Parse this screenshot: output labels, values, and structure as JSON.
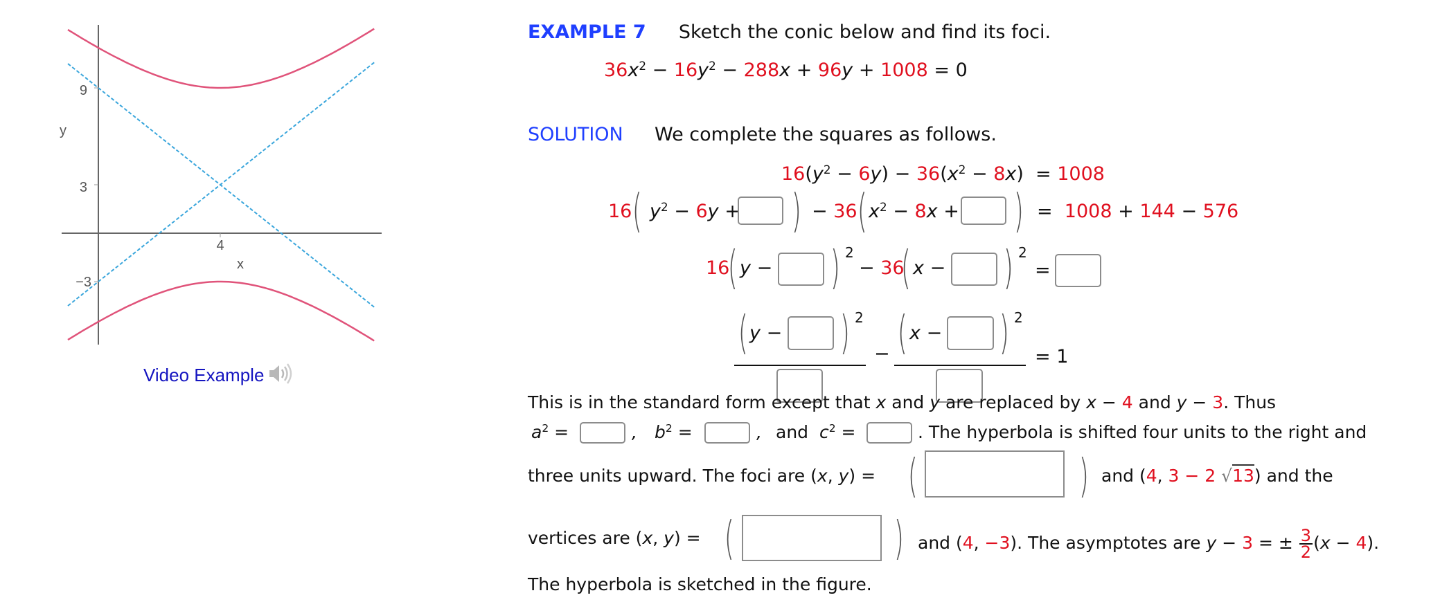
{
  "figure": {
    "axis_labels": {
      "x": "x",
      "y": "y"
    },
    "ticks": {
      "x": [
        "4"
      ],
      "y": [
        "9",
        "3",
        "−3"
      ]
    },
    "colors": {
      "hyperbola": "#e0537a",
      "asymptote": "#3aa6dc",
      "axis": "#666666"
    },
    "video_example_label": "Video Example",
    "audio_icon": "speaker-icon"
  },
  "chart_data": {
    "type": "line",
    "title": "",
    "xlabel": "x",
    "ylabel": "y",
    "xlim": [
      -1,
      9
    ],
    "ylim": [
      -7,
      13
    ],
    "xticks": [
      4
    ],
    "yticks": [
      9,
      3,
      -3
    ],
    "grid": false,
    "series": [
      {
        "name": "hyperbola-upper",
        "style": "solid",
        "equation": "(y-3)^2/36 - (x-4)^2/16 = 1, upper branch"
      },
      {
        "name": "hyperbola-lower",
        "style": "solid",
        "equation": "(y-3)^2/36 - (x-4)^2/16 = 1, lower branch"
      },
      {
        "name": "asymptote-positive",
        "style": "dashed",
        "equation": "y - 3 = 3/2 (x - 4)"
      },
      {
        "name": "asymptote-negative",
        "style": "dashed",
        "equation": "y - 3 = -3/2 (x - 4)"
      }
    ],
    "center": [
      4,
      3
    ],
    "a": 6,
    "b": 4
  },
  "example": {
    "label": "EXAMPLE 7",
    "prompt": "Sketch the conic below and find its foci.",
    "equation": {
      "c1": "36",
      "v1": "x",
      "t1": " − ",
      "c2": "16",
      "v2": "y",
      "t2": " − ",
      "c3": "288",
      "v3": "x",
      "t3": " + ",
      "c4": "96",
      "v4": "y",
      "t4": " + ",
      "c5": "1008",
      "t5": " = 0",
      "exp": "2"
    }
  },
  "solution": {
    "label": "SOLUTION",
    "intro": "We complete the squares as follows.",
    "row1": {
      "a": "16",
      "b": "(",
      "c": "y",
      "d": "2",
      "e": " − ",
      "f": "6",
      "g": "y",
      "h": ") − ",
      "i": "36",
      "j": "(",
      "k": "x",
      "l": "2",
      "m": " − ",
      "n": "8",
      "o": "x",
      "p": ")",
      "eq": "= ",
      "rhs": "1008"
    },
    "row2": {
      "c1": "16",
      "y": "y",
      "exp": "2",
      "m1": " − ",
      "c2": "6",
      "y2": "y",
      "plus": " +",
      "minus36": "− ",
      "c3": "36",
      "x": "x",
      "m2": " − ",
      "c4": "8",
      "x2": "x",
      "plus2": " +",
      "eq": "=",
      "r1": "1008",
      "p": " + ",
      "r2": "144",
      "m": " − ",
      "r3": "576"
    },
    "row3": {
      "c1": "16",
      "y": "y",
      "m1": " −",
      "exp": "2",
      "minus": "−",
      "c2": "36",
      "x": "x",
      "m2": " −",
      "eq": "="
    },
    "row4": {
      "y": "y",
      "m1": " −",
      "exp": "2",
      "minus": "−",
      "x": "x",
      "m2": " −",
      "eq": "= 1"
    },
    "para": {
      "l1a": "This is in the standard form except that ",
      "l1x": "x",
      "l1b": " and ",
      "l1y": "y",
      "l1c": " are replaced by  ",
      "l1x2": "x",
      "l1m": " − ",
      "l1four": "4",
      "l1and": "  and  ",
      "l1y2": "y",
      "l1m2": " − ",
      "l1three": "3",
      "l1end": ".  Thus",
      "a2": "a",
      "b2": "b",
      "c2": "c",
      "exp": "2",
      "eq": " =",
      "comma": ",",
      "and": "and",
      "l2end": ".  The hyperbola is shifted four units to the right and",
      "l3a": "three units upward. The foci are  (",
      "l3x": "x",
      "l3c": ", ",
      "l3y": "y",
      "l3b": ") =",
      "l3and": "and  (",
      "l3four": "4",
      "l3comma": ", ",
      "l3three": "3",
      "l3minus": " − ",
      "l3two": "2",
      "l3sqrt": "√",
      "l3thirteen": "13",
      "l3end": ")  and the",
      "l4a": "vertices are  (",
      "l4and": "and  (",
      "l4four": "4",
      "l4comma": ", ",
      "l4neg3": "−3",
      "l4mid": ").  The asymptotes are  ",
      "l4y": "y",
      "l4m": " − ",
      "l4three": "3",
      "l4eq": " = ± ",
      "l4num": "3",
      "l4den": "2",
      "l4paren": "(",
      "l4x": "x",
      "l4m2": " − ",
      "l4four2": "4",
      "l4end": ").",
      "l5": "The hyperbola is sketched in the figure."
    }
  }
}
